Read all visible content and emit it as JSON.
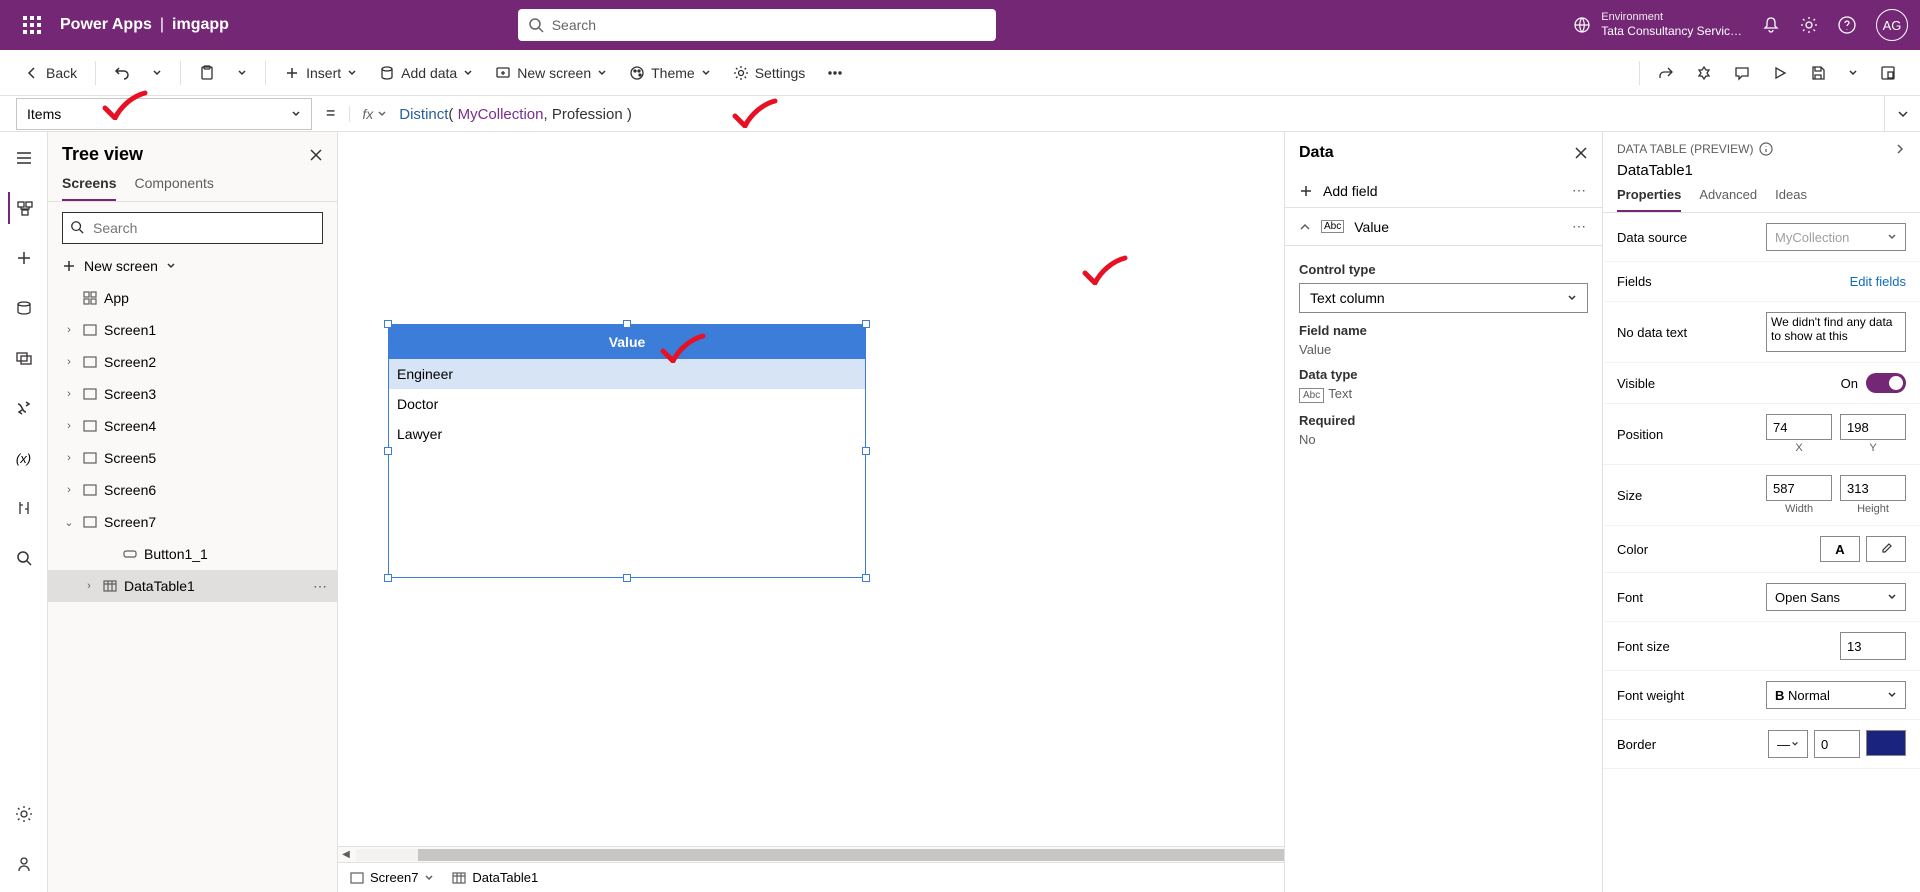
{
  "top": {
    "brand": "Power Apps",
    "appname": "imgapp",
    "search_placeholder": "Search",
    "env_label": "Environment",
    "env_name": "Tata Consultancy Servic…",
    "avatar": "AG"
  },
  "cmd": {
    "back": "Back",
    "insert": "Insert",
    "adddata": "Add data",
    "newscreen": "New screen",
    "theme": "Theme",
    "settings": "Settings"
  },
  "formula": {
    "property": "Items",
    "fx": "fx",
    "fn": "Distinct",
    "id": "MyCollection",
    "arg": "Profession"
  },
  "tree": {
    "title": "Tree view",
    "tab_screens": "Screens",
    "tab_components": "Components",
    "search_placeholder": "Search",
    "new_screen": "New screen",
    "app": "App",
    "screens": [
      "Screen1",
      "Screen2",
      "Screen3",
      "Screen4",
      "Screen5",
      "Screen6",
      "Screen7"
    ],
    "button": "Button1_1",
    "datatable": "DataTable1"
  },
  "table": {
    "header": "Value",
    "rows": [
      "Engineer",
      "Doctor",
      "Lawyer"
    ]
  },
  "data": {
    "title": "Data",
    "addfield": "Add field",
    "value": "Value",
    "controltype_lbl": "Control type",
    "controltype_val": "Text column",
    "fieldname_lbl": "Field name",
    "fieldname_val": "Value",
    "datatype_lbl": "Data type",
    "datatype_icon": "Abc",
    "datatype_val": "Text",
    "required_lbl": "Required",
    "required_val": "No"
  },
  "props": {
    "head": "DATA TABLE (PREVIEW)",
    "title": "DataTable1",
    "tab_props": "Properties",
    "tab_adv": "Advanced",
    "tab_ideas": "Ideas",
    "datasource_lbl": "Data source",
    "datasource_val": "MyCollection",
    "fields_lbl": "Fields",
    "editfields": "Edit fields",
    "nodata_lbl": "No data text",
    "nodata_val": "We didn't find any data to show at this",
    "visible_lbl": "Visible",
    "visible_val": "On",
    "position_lbl": "Position",
    "pos_x": "74",
    "pos_y": "198",
    "pos_xl": "X",
    "pos_yl": "Y",
    "size_lbl": "Size",
    "size_w": "587",
    "size_h": "313",
    "size_wl": "Width",
    "size_hl": "Height",
    "color_lbl": "Color",
    "font_lbl": "Font",
    "font_val": "Open Sans",
    "fontsize_lbl": "Font size",
    "fontsize_val": "13",
    "fontweight_lbl": "Font weight",
    "fontweight_val": "Normal",
    "fontweight_prefix": "B",
    "border_lbl": "Border",
    "border_val": "0"
  },
  "breadcrumb": {
    "screen": "Screen7",
    "control": "DataTable1"
  }
}
